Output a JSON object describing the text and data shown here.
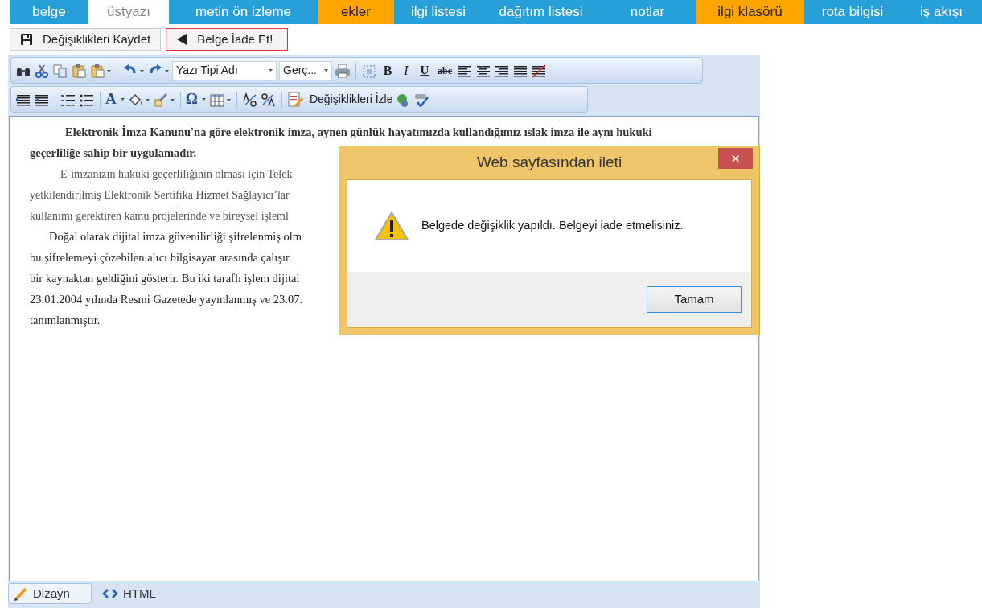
{
  "tabs": [
    {
      "label": "belge",
      "selected": false,
      "color": "#279fd9"
    },
    {
      "label": "üstyazı",
      "selected": true
    },
    {
      "label": "metin ön izleme",
      "selected": false,
      "color": "#279fd9"
    },
    {
      "label": "ekler",
      "selected": false,
      "color": "#ffa500"
    },
    {
      "label": "ilgi listesi",
      "selected": false,
      "color": "#279fd9"
    },
    {
      "label": "dağıtım listesi",
      "selected": false,
      "color": "#279fd9"
    },
    {
      "label": "notlar",
      "selected": false,
      "color": "#279fd9"
    },
    {
      "label": "ilgi klasörü",
      "selected": false,
      "color": "#ffa500"
    },
    {
      "label": "rota bilgisi",
      "selected": false,
      "color": "#279fd9"
    },
    {
      "label": "iş akışı",
      "selected": false,
      "color": "#279fd9"
    }
  ],
  "actions": [
    {
      "label": "Değişiklikleri Kaydet",
      "highlighted": false
    },
    {
      "label": "Belge İade Et!",
      "highlighted": true
    }
  ],
  "toolbar": {
    "font_name": "Yazı Tipi Adı",
    "font_size": "Gerç...",
    "bold": "B",
    "italic": "I",
    "underline": "U",
    "strike": "abc",
    "font_color": "A",
    "symbol": "Ω",
    "track_changes": "Değişiklikleri İzle"
  },
  "document": [
    {
      "kind": "bold",
      "lines": [
        "Elektronik İmza Kanunu'na göre elektronik imza, aynen günlük hayatımızda kullandığımız ıslak imza ile aynı hukuki",
        "geçerliliğe sahip bir uygulamadır."
      ]
    },
    {
      "kind": "gray",
      "lines": [
        "E-imzanızın hukuki geçerliliğinin olması için Telek",
        "yetkilendirilmiş Elektronik Sertifika Hizmet Sağlayıcı’lar",
        "kullanımı gerektiren kamu projelerinde ve bireysel işleml"
      ]
    },
    {
      "kind": "plain",
      "lines": [
        "Doğal olarak dijital imza güvenilirliği şifrelenmiş olm",
        "bu şifrelemeyi çözebilen alıcı bilgisayar arasında çalışır.",
        "bir kaynaktan geldiğini gösterir. Bu iki taraflı işlem dijital",
        "23.01.2004 yılında Resmi Gazetede yayınlanmış ve 23.07.",
        "tanımlanmıştır."
      ]
    }
  ],
  "modes": [
    {
      "label": "Dizayn",
      "selected": true
    },
    {
      "label": "HTML",
      "selected": false
    }
  ],
  "dialog": {
    "title": "Web sayfasından ileti",
    "close": "×",
    "message": "Belgede değişiklik yapıldı. Belgeyi iade etmelisiniz.",
    "button": "Tamam"
  }
}
